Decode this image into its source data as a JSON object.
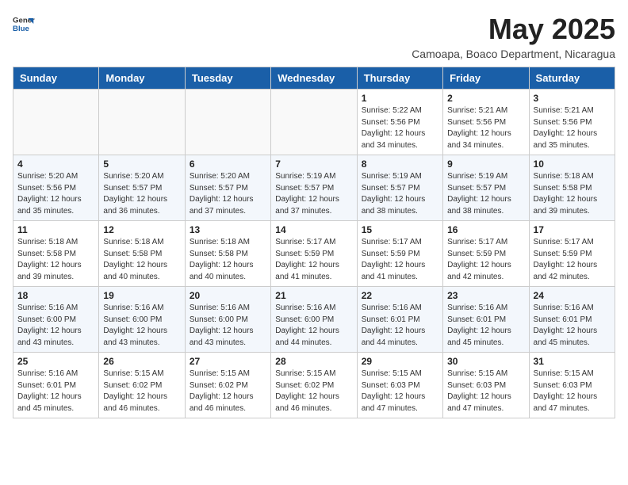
{
  "header": {
    "logo_general": "General",
    "logo_blue": "Blue",
    "title": "May 2025",
    "subtitle": "Camoapa, Boaco Department, Nicaragua"
  },
  "weekdays": [
    "Sunday",
    "Monday",
    "Tuesday",
    "Wednesday",
    "Thursday",
    "Friday",
    "Saturday"
  ],
  "weeks": [
    [
      {
        "day": "",
        "info": ""
      },
      {
        "day": "",
        "info": ""
      },
      {
        "day": "",
        "info": ""
      },
      {
        "day": "",
        "info": ""
      },
      {
        "day": "1",
        "info": "Sunrise: 5:22 AM\nSunset: 5:56 PM\nDaylight: 12 hours\nand 34 minutes."
      },
      {
        "day": "2",
        "info": "Sunrise: 5:21 AM\nSunset: 5:56 PM\nDaylight: 12 hours\nand 34 minutes."
      },
      {
        "day": "3",
        "info": "Sunrise: 5:21 AM\nSunset: 5:56 PM\nDaylight: 12 hours\nand 35 minutes."
      }
    ],
    [
      {
        "day": "4",
        "info": "Sunrise: 5:20 AM\nSunset: 5:56 PM\nDaylight: 12 hours\nand 35 minutes."
      },
      {
        "day": "5",
        "info": "Sunrise: 5:20 AM\nSunset: 5:57 PM\nDaylight: 12 hours\nand 36 minutes."
      },
      {
        "day": "6",
        "info": "Sunrise: 5:20 AM\nSunset: 5:57 PM\nDaylight: 12 hours\nand 37 minutes."
      },
      {
        "day": "7",
        "info": "Sunrise: 5:19 AM\nSunset: 5:57 PM\nDaylight: 12 hours\nand 37 minutes."
      },
      {
        "day": "8",
        "info": "Sunrise: 5:19 AM\nSunset: 5:57 PM\nDaylight: 12 hours\nand 38 minutes."
      },
      {
        "day": "9",
        "info": "Sunrise: 5:19 AM\nSunset: 5:57 PM\nDaylight: 12 hours\nand 38 minutes."
      },
      {
        "day": "10",
        "info": "Sunrise: 5:18 AM\nSunset: 5:58 PM\nDaylight: 12 hours\nand 39 minutes."
      }
    ],
    [
      {
        "day": "11",
        "info": "Sunrise: 5:18 AM\nSunset: 5:58 PM\nDaylight: 12 hours\nand 39 minutes."
      },
      {
        "day": "12",
        "info": "Sunrise: 5:18 AM\nSunset: 5:58 PM\nDaylight: 12 hours\nand 40 minutes."
      },
      {
        "day": "13",
        "info": "Sunrise: 5:18 AM\nSunset: 5:58 PM\nDaylight: 12 hours\nand 40 minutes."
      },
      {
        "day": "14",
        "info": "Sunrise: 5:17 AM\nSunset: 5:59 PM\nDaylight: 12 hours\nand 41 minutes."
      },
      {
        "day": "15",
        "info": "Sunrise: 5:17 AM\nSunset: 5:59 PM\nDaylight: 12 hours\nand 41 minutes."
      },
      {
        "day": "16",
        "info": "Sunrise: 5:17 AM\nSunset: 5:59 PM\nDaylight: 12 hours\nand 42 minutes."
      },
      {
        "day": "17",
        "info": "Sunrise: 5:17 AM\nSunset: 5:59 PM\nDaylight: 12 hours\nand 42 minutes."
      }
    ],
    [
      {
        "day": "18",
        "info": "Sunrise: 5:16 AM\nSunset: 6:00 PM\nDaylight: 12 hours\nand 43 minutes."
      },
      {
        "day": "19",
        "info": "Sunrise: 5:16 AM\nSunset: 6:00 PM\nDaylight: 12 hours\nand 43 minutes."
      },
      {
        "day": "20",
        "info": "Sunrise: 5:16 AM\nSunset: 6:00 PM\nDaylight: 12 hours\nand 43 minutes."
      },
      {
        "day": "21",
        "info": "Sunrise: 5:16 AM\nSunset: 6:00 PM\nDaylight: 12 hours\nand 44 minutes."
      },
      {
        "day": "22",
        "info": "Sunrise: 5:16 AM\nSunset: 6:01 PM\nDaylight: 12 hours\nand 44 minutes."
      },
      {
        "day": "23",
        "info": "Sunrise: 5:16 AM\nSunset: 6:01 PM\nDaylight: 12 hours\nand 45 minutes."
      },
      {
        "day": "24",
        "info": "Sunrise: 5:16 AM\nSunset: 6:01 PM\nDaylight: 12 hours\nand 45 minutes."
      }
    ],
    [
      {
        "day": "25",
        "info": "Sunrise: 5:16 AM\nSunset: 6:01 PM\nDaylight: 12 hours\nand 45 minutes."
      },
      {
        "day": "26",
        "info": "Sunrise: 5:15 AM\nSunset: 6:02 PM\nDaylight: 12 hours\nand 46 minutes."
      },
      {
        "day": "27",
        "info": "Sunrise: 5:15 AM\nSunset: 6:02 PM\nDaylight: 12 hours\nand 46 minutes."
      },
      {
        "day": "28",
        "info": "Sunrise: 5:15 AM\nSunset: 6:02 PM\nDaylight: 12 hours\nand 46 minutes."
      },
      {
        "day": "29",
        "info": "Sunrise: 5:15 AM\nSunset: 6:03 PM\nDaylight: 12 hours\nand 47 minutes."
      },
      {
        "day": "30",
        "info": "Sunrise: 5:15 AM\nSunset: 6:03 PM\nDaylight: 12 hours\nand 47 minutes."
      },
      {
        "day": "31",
        "info": "Sunrise: 5:15 AM\nSunset: 6:03 PM\nDaylight: 12 hours\nand 47 minutes."
      }
    ]
  ]
}
